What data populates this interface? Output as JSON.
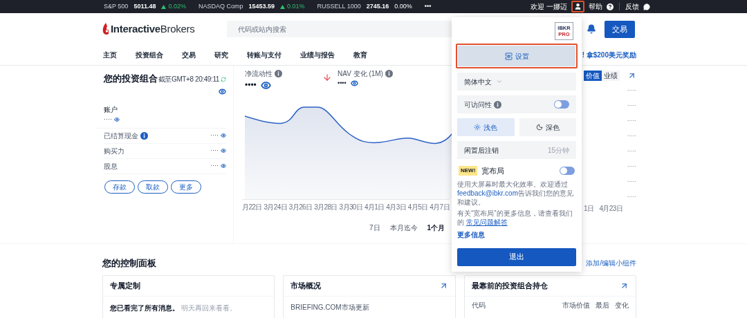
{
  "ticker": [
    {
      "name": "S&P 500",
      "value": "5011.48",
      "change": "0.02%",
      "up": true
    },
    {
      "name": "NASDAQ Comp",
      "value": "15453.59",
      "change": "0.01%",
      "up": true
    },
    {
      "name": "RUSSELL 1000",
      "value": "2745.16",
      "change": "0.00%",
      "up": false
    }
  ],
  "ticker_more": "•••",
  "user_bar": {
    "welcome": "欢迎 一娜迈",
    "help": "帮助",
    "feedback": "反馈"
  },
  "logo": {
    "bold": "Interactive",
    "light": "Brokers"
  },
  "search": {
    "placeholder": "代码或站内搜索"
  },
  "trade_button": "交易",
  "nav": [
    "主页",
    "投资组合",
    "交易",
    "研究",
    "转账与支付",
    "业绩与报告",
    "教育"
  ],
  "promo": "! 拿$200美元奖励",
  "portfolio": {
    "title": "您的投资组合",
    "timestamp": "截至GMT+8 20:49:11",
    "account_label": "账户",
    "account_value": "····",
    "rows": [
      {
        "label": "已结算现金",
        "info": true,
        "value": "····"
      },
      {
        "label": "购买力",
        "info": false,
        "value": "····"
      },
      {
        "label": "股息",
        "info": false,
        "value": "····"
      }
    ],
    "buttons": [
      "存款",
      "取款",
      "更多"
    ]
  },
  "chart_panel": {
    "metrics": [
      {
        "label": "净流动性",
        "value": "••••",
        "falling": false
      },
      {
        "label": "NAV 变化 (1M)",
        "value": "••••",
        "falling": true
      }
    ],
    "view_tabs": [
      {
        "label": "价值",
        "selected": true
      },
      {
        "label": "业绩",
        "selected": false
      }
    ],
    "side_values": [
      "·····",
      "·····",
      "·····",
      "·····",
      "·····",
      "·····",
      "·····",
      "·····"
    ],
    "x_labels": [
      "月22日",
      "3月24日",
      "3月26日",
      "3月28日",
      "3月30日",
      "4月1日",
      "4月3日",
      "4月5日",
      "4月7日"
    ],
    "x_labels_right": [
      "1日",
      "4月23日"
    ],
    "ranges": [
      {
        "label": "7日",
        "selected": false
      },
      {
        "label": "本月迄今",
        "selected": false
      },
      {
        "label": "1个月",
        "selected": true
      }
    ]
  },
  "dropdown": {
    "badge": {
      "top": "IBKR",
      "bottom": "PRO"
    },
    "settings": "设置",
    "language": "简体中文",
    "accessibility": {
      "label": "可访问性",
      "on": false
    },
    "themes": [
      {
        "label": "浅色",
        "kind": "light",
        "selected": true
      },
      {
        "label": "深色",
        "kind": "dark",
        "selected": false
      }
    ],
    "idle_logout": {
      "label": "闲置后注销",
      "value": "15分钟"
    },
    "wide_layout": {
      "badge": "NEW!",
      "label": "宽布局",
      "on": false,
      "description": "使用大屏幕时最大化效率。欢迎通过",
      "email": "feedback@ibkr.com",
      "description_end": "告诉我们您的意见和建议。",
      "faq_text": "有关“宽布局”的更多信息，请查看我们的",
      "faq_link": "常见问题解答",
      "more": "更多信息"
    },
    "logout": "退出"
  },
  "dashboard": {
    "title": "您的控制面板",
    "add_link": "添加/编辑小组件",
    "cards": [
      {
        "kind": "messages",
        "title": "专属定制",
        "arrow": false,
        "text": "**您已看完了所有消息。** 明天再回来看看。"
      },
      {
        "kind": "news",
        "title": "市场概况",
        "arrow": true,
        "source": "BRIEFING.COM市场更新"
      },
      {
        "kind": "positions",
        "title": "最靠前的投资组合持仓",
        "arrow": true,
        "columns": [
          "代码",
          "市场价值",
          "最后",
          "变化"
        ]
      }
    ]
  }
}
